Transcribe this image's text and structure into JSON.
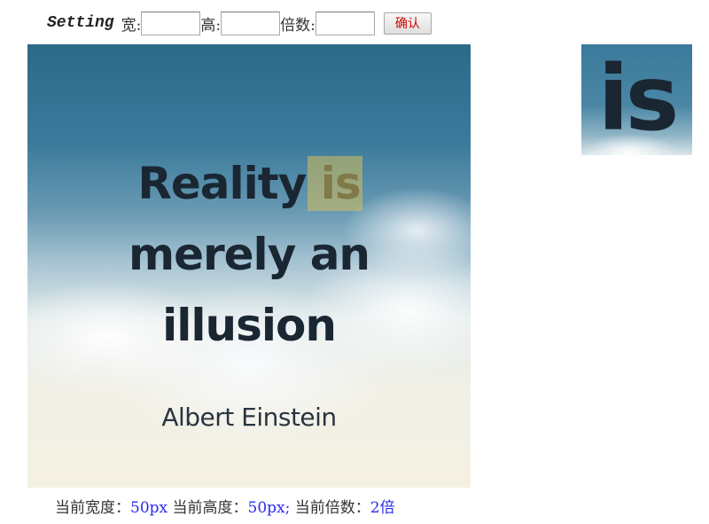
{
  "settings": {
    "title": "Setting",
    "width_label": "宽:",
    "width_value": "",
    "height_label": "高:",
    "height_value": "",
    "zoom_label": "倍数:",
    "zoom_value": "",
    "confirm_label": "确认"
  },
  "image": {
    "quote_lines": [
      "Reality is",
      "merely an",
      "illusion"
    ],
    "author": "Albert Einstein",
    "highlight_word": "is"
  },
  "zoom_preview": {
    "text": "is"
  },
  "status": {
    "width_label": "当前宽度：",
    "width_value": "50px",
    "height_label": " 当前高度：",
    "height_value": "50px",
    "sep": "; ",
    "zoom_label": "当前倍数：",
    "zoom_value": "2倍"
  },
  "colors": {
    "confirm_text": "#d40000",
    "status_value": "#2a2af0",
    "selection": "#d6be5a"
  }
}
